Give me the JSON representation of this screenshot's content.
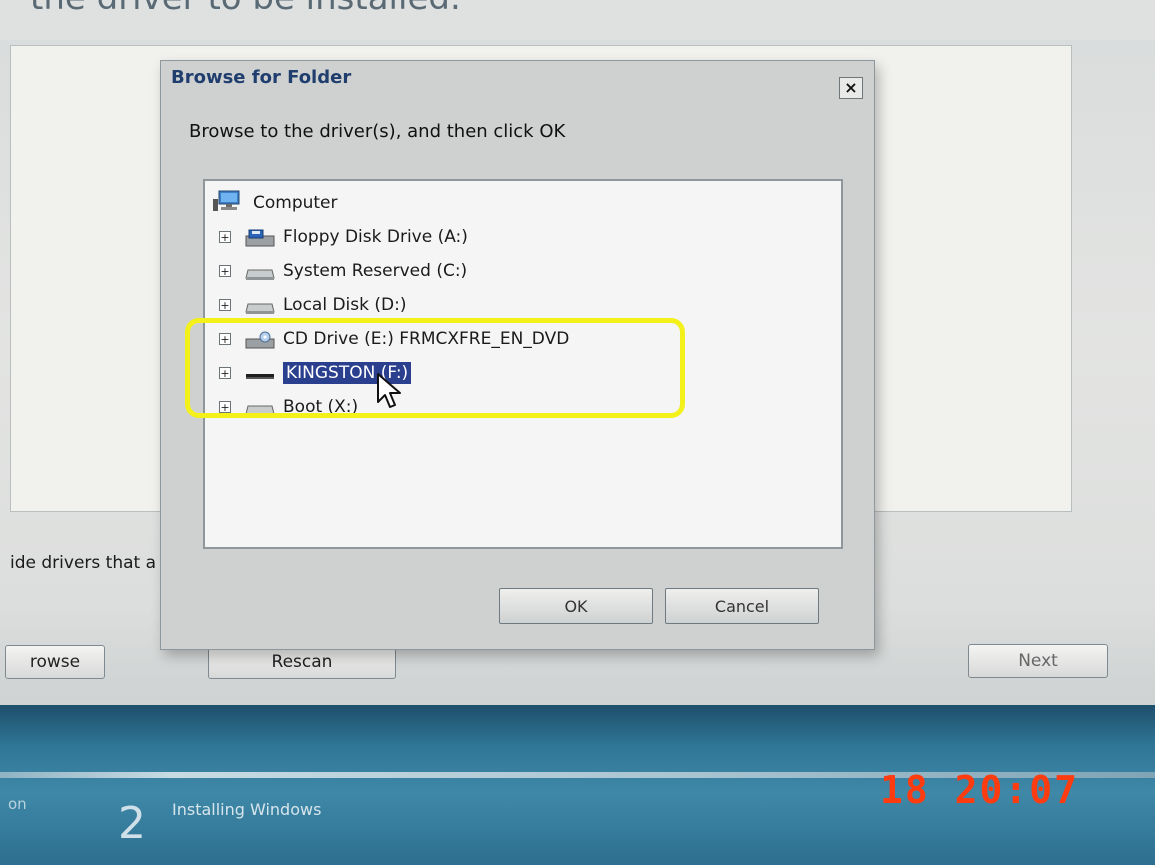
{
  "background": {
    "top_text": "the driver to be installed.",
    "hint_text": "ide drivers that a",
    "browse_button": "rowse",
    "rescan_button": "Rescan",
    "next_button": "Next"
  },
  "dialog": {
    "title": "Browse for Folder",
    "close_label": "×",
    "instruction": "Browse to the driver(s), and then click OK",
    "tree": {
      "root": "Computer",
      "items": [
        {
          "label": "Floppy Disk Drive (A:)",
          "icon": "floppy-drive-icon"
        },
        {
          "label": "System Reserved (C:)",
          "icon": "hard-disk-icon"
        },
        {
          "label": "Local Disk (D:)",
          "icon": "hard-disk-icon"
        },
        {
          "label": "CD Drive (E:) FRMCXFRE_EN_DVD",
          "icon": "cd-drive-icon"
        },
        {
          "label": "KINGSTON (F:)",
          "icon": "usb-drive-icon",
          "selected": true
        },
        {
          "label": "Boot (X:)",
          "icon": "hard-disk-icon"
        }
      ],
      "expander_symbol": "+"
    },
    "ok_button": "OK",
    "cancel_button": "Cancel"
  },
  "setup_steps": {
    "prev_step_fragment": "on",
    "step_number": "2",
    "step_label": "Installing Windows"
  },
  "camera_stamp": "18  20:07",
  "colors": {
    "selection": "#2b3f8f",
    "highlight_ring": "#f4f01a",
    "stamp": "#ff3b10",
    "title_text": "#1f3e6e"
  }
}
